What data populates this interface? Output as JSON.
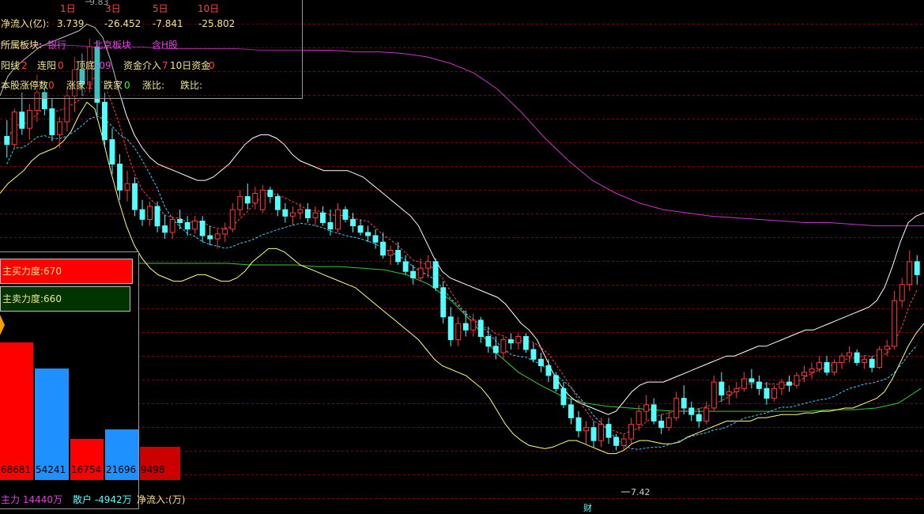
{
  "colors": {
    "up": "#ff3a3a",
    "down": "#54ffff",
    "upper_band": "#ffffff",
    "lower_band": "#ffff80",
    "ma_dashed_red": "#ff4040",
    "ma_dashed_cyan": "#40d0ff",
    "long_ma_magenta": "#cc33cc",
    "long_ma_green": "#33cc33",
    "grid": "#8b0000"
  },
  "info": {
    "periods": [
      "1日",
      "3日",
      "5日",
      "10日"
    ],
    "net_inflow_label": "净流入(亿):",
    "net_inflow_values": [
      "3.739",
      "-26.452",
      "-7.841",
      "-25.802"
    ],
    "sector_label": "所属板块:",
    "sector_items": [
      "银行",
      "北京板块",
      "含H股"
    ],
    "row3_yang_label": "阳线",
    "row3_yang_value": "2",
    "row3_lian_label": "连阳",
    "row3_lian_value": "0",
    "row3_ding_label": "顶底",
    "row3_ding_value": "-09",
    "row3_fund_in_label": "资金介入",
    "row3_fund_in_value": "7",
    "row3_ten_label": "10日资金",
    "row3_ten_value": "0",
    "row4_limit_label": "本股涨停数",
    "row4_limit_value": "0",
    "row4_up_label": "涨家",
    "row4_up_value": "1",
    "row4_down_label": "跌家",
    "row4_down_value": "0",
    "row4_upratio_label": "涨比:",
    "row4_downratio_label": "跌比:"
  },
  "fund_flow": {
    "buy_force": "主买力度:670",
    "sell_force": "主卖力度:660",
    "main_force": "主力 14440万",
    "retail": "散户 -4942万",
    "net_inflow": "净流入:(万)"
  },
  "annotations": {
    "high_price": "9.83",
    "low_price": "7.42",
    "marker_cai": "财"
  },
  "chart_data": {
    "type": "candlestick",
    "ylim": [
      7.15,
      10.15
    ],
    "grid": true,
    "candles": [
      [
        9.35,
        9.45,
        9.22,
        9.3
      ],
      [
        9.3,
        9.52,
        9.28,
        9.5
      ],
      [
        9.5,
        9.62,
        9.36,
        9.4
      ],
      [
        9.4,
        9.55,
        9.33,
        9.51
      ],
      [
        9.51,
        9.73,
        9.44,
        9.62
      ],
      [
        9.62,
        9.66,
        9.48,
        9.52
      ],
      [
        9.52,
        9.58,
        9.32,
        9.36
      ],
      [
        9.36,
        9.47,
        9.28,
        9.44
      ],
      [
        9.44,
        9.66,
        9.38,
        9.6
      ],
      [
        9.6,
        9.84,
        9.5,
        9.76
      ],
      [
        9.76,
        9.86,
        9.6,
        9.67
      ],
      [
        9.67,
        9.95,
        9.62,
        9.9
      ],
      [
        9.9,
        9.94,
        9.48,
        9.56
      ],
      [
        9.56,
        9.62,
        9.28,
        9.33
      ],
      [
        9.33,
        9.4,
        9.12,
        9.18
      ],
      [
        9.18,
        9.24,
        8.96,
        9.02
      ],
      [
        9.02,
        9.14,
        8.95,
        9.06
      ],
      [
        9.06,
        9.1,
        8.86,
        8.9
      ],
      [
        8.9,
        8.96,
        8.8,
        8.84
      ],
      [
        8.84,
        8.95,
        8.8,
        8.92
      ],
      [
        8.92,
        8.95,
        8.76,
        8.8
      ],
      [
        8.8,
        8.87,
        8.72,
        8.76
      ],
      [
        8.76,
        8.86,
        8.72,
        8.84
      ],
      [
        8.84,
        8.9,
        8.78,
        8.82
      ],
      [
        8.82,
        8.86,
        8.74,
        8.78
      ],
      [
        8.78,
        8.86,
        8.75,
        8.83
      ],
      [
        8.83,
        8.86,
        8.7,
        8.74
      ],
      [
        8.74,
        8.8,
        8.68,
        8.72
      ],
      [
        8.72,
        8.78,
        8.66,
        8.75
      ],
      [
        8.75,
        8.82,
        8.7,
        8.78
      ],
      [
        8.78,
        8.94,
        8.76,
        8.9
      ],
      [
        8.9,
        9.02,
        8.86,
        8.98
      ],
      [
        8.98,
        9.06,
        8.9,
        8.94
      ],
      [
        8.94,
        9.04,
        8.9,
        9.0
      ],
      [
        8.9,
        9.05,
        8.88,
        9.02
      ],
      [
        9.02,
        9.04,
        8.94,
        8.98
      ],
      [
        8.98,
        9.0,
        8.86,
        8.9
      ],
      [
        8.9,
        8.94,
        8.82,
        8.86
      ],
      [
        8.86,
        8.92,
        8.8,
        8.88
      ],
      [
        8.88,
        8.94,
        8.84,
        8.9
      ],
      [
        8.9,
        8.94,
        8.82,
        8.85
      ],
      [
        8.85,
        8.92,
        8.8,
        8.88
      ],
      [
        8.88,
        8.92,
        8.8,
        8.82
      ],
      [
        8.82,
        8.9,
        8.74,
        8.78
      ],
      [
        8.78,
        8.94,
        8.76,
        8.9
      ],
      [
        8.9,
        8.92,
        8.82,
        8.84
      ],
      [
        8.84,
        8.88,
        8.76,
        8.8
      ],
      [
        8.8,
        8.84,
        8.74,
        8.76
      ],
      [
        8.76,
        8.8,
        8.7,
        8.74
      ],
      [
        8.74,
        8.78,
        8.66,
        8.7
      ],
      [
        8.7,
        8.76,
        8.6,
        8.62
      ],
      [
        8.62,
        8.68,
        8.56,
        8.65
      ],
      [
        8.65,
        8.7,
        8.56,
        8.58
      ],
      [
        8.58,
        8.62,
        8.5,
        8.52
      ],
      [
        8.52,
        8.56,
        8.44,
        8.48
      ],
      [
        8.48,
        8.6,
        8.46,
        8.54
      ],
      [
        8.54,
        8.62,
        8.48,
        8.58
      ],
      [
        8.58,
        8.6,
        8.4,
        8.42
      ],
      [
        8.42,
        8.46,
        8.2,
        8.24
      ],
      [
        8.24,
        8.3,
        8.06,
        8.1
      ],
      [
        8.1,
        8.24,
        8.06,
        8.2
      ],
      [
        8.2,
        8.28,
        8.12,
        8.16
      ],
      [
        8.16,
        8.26,
        8.12,
        8.22
      ],
      [
        8.22,
        8.24,
        8.08,
        8.12
      ],
      [
        8.12,
        8.18,
        8.02,
        8.06
      ],
      [
        8.06,
        8.12,
        7.98,
        8.02
      ],
      [
        8.02,
        8.12,
        7.98,
        8.1
      ],
      [
        8.1,
        8.14,
        8.04,
        8.08
      ],
      [
        8.08,
        8.14,
        8.04,
        8.12
      ],
      [
        8.12,
        8.14,
        8.02,
        8.04
      ],
      [
        8.04,
        8.08,
        7.96,
        7.98
      ],
      [
        7.98,
        8.02,
        7.9,
        7.94
      ],
      [
        7.94,
        7.98,
        7.84,
        7.88
      ],
      [
        7.88,
        7.9,
        7.78,
        7.8
      ],
      [
        7.8,
        7.84,
        7.68,
        7.7
      ],
      [
        7.7,
        7.74,
        7.58,
        7.62
      ],
      [
        7.62,
        7.66,
        7.5,
        7.54
      ],
      [
        7.54,
        7.6,
        7.46,
        7.56
      ],
      [
        7.56,
        7.6,
        7.44,
        7.48
      ],
      [
        7.48,
        7.62,
        7.44,
        7.58
      ],
      [
        7.58,
        7.62,
        7.46,
        7.5
      ],
      [
        7.5,
        7.52,
        7.42,
        7.45
      ],
      [
        7.45,
        7.52,
        7.42,
        7.49
      ],
      [
        7.49,
        7.62,
        7.46,
        7.58
      ],
      [
        7.58,
        7.7,
        7.54,
        7.66
      ],
      [
        7.66,
        7.76,
        7.6,
        7.7
      ],
      [
        7.7,
        7.74,
        7.58,
        7.6
      ],
      [
        7.6,
        7.64,
        7.52,
        7.56
      ],
      [
        7.56,
        7.66,
        7.54,
        7.62
      ],
      [
        7.62,
        7.78,
        7.6,
        7.74
      ],
      [
        7.74,
        7.82,
        7.64,
        7.68
      ],
      [
        7.68,
        7.72,
        7.6,
        7.64
      ],
      [
        7.64,
        7.68,
        7.56,
        7.6
      ],
      [
        7.6,
        7.72,
        7.58,
        7.68
      ],
      [
        7.68,
        7.88,
        7.66,
        7.84
      ],
      [
        7.84,
        7.9,
        7.72,
        7.76
      ],
      [
        7.76,
        7.82,
        7.7,
        7.78
      ],
      [
        7.78,
        7.84,
        7.74,
        7.8
      ],
      [
        7.8,
        7.9,
        7.78,
        7.86
      ],
      [
        7.86,
        7.92,
        7.8,
        7.84
      ],
      [
        7.84,
        7.88,
        7.76,
        7.8
      ],
      [
        7.8,
        7.84,
        7.7,
        7.74
      ],
      [
        7.74,
        7.82,
        7.72,
        7.8
      ],
      [
        7.8,
        7.86,
        7.76,
        7.84
      ],
      [
        7.84,
        7.88,
        7.78,
        7.82
      ],
      [
        7.82,
        7.9,
        7.8,
        7.88
      ],
      [
        7.88,
        7.94,
        7.84,
        7.9
      ],
      [
        7.9,
        7.96,
        7.86,
        7.92
      ],
      [
        7.92,
        8.0,
        7.9,
        7.96
      ],
      [
        7.96,
        8.0,
        7.88,
        7.9
      ],
      [
        7.9,
        7.98,
        7.88,
        7.96
      ],
      [
        7.96,
        8.02,
        7.92,
        8.0
      ],
      [
        8.0,
        8.06,
        7.96,
        8.02
      ],
      [
        8.02,
        8.04,
        7.94,
        7.96
      ],
      [
        7.96,
        8.0,
        7.92,
        7.98
      ],
      [
        7.98,
        8.0,
        7.9,
        7.93
      ],
      [
        7.93,
        8.06,
        7.92,
        8.04
      ],
      [
        8.04,
        8.1,
        8.0,
        8.06
      ],
      [
        8.06,
        8.4,
        8.04,
        8.34
      ],
      [
        8.34,
        8.48,
        8.3,
        8.44
      ],
      [
        8.44,
        8.65,
        8.4,
        8.58
      ],
      [
        8.58,
        8.62,
        8.44,
        8.5
      ]
    ],
    "upper_band": [
      9.6,
      9.72,
      9.78,
      9.82,
      9.86,
      9.9,
      9.92,
      9.94,
      9.96,
      9.98,
      10.0,
      10.04,
      10.02,
      9.96,
      9.82,
      9.64,
      9.48,
      9.36,
      9.28,
      9.22,
      9.18,
      9.16,
      9.14,
      9.12,
      9.1,
      9.08,
      9.08,
      9.1,
      9.14,
      9.18,
      9.24,
      9.3,
      9.34,
      9.36,
      9.36,
      9.34,
      9.3,
      9.24,
      9.2,
      9.18,
      9.16,
      9.14,
      9.14,
      9.14,
      9.14,
      9.12,
      9.1,
      9.06,
      9.02,
      8.98,
      8.94,
      8.9,
      8.86,
      8.8,
      8.7,
      8.6,
      8.52,
      8.48,
      8.46,
      8.44,
      8.42,
      8.4,
      8.38,
      8.36,
      8.32,
      8.26,
      8.2,
      8.16,
      8.1,
      8.0,
      7.9,
      7.82,
      7.76,
      7.72,
      7.7,
      7.68,
      7.66,
      7.64,
      7.66,
      7.72,
      7.78,
      7.82,
      7.84,
      7.84,
      7.84,
      7.86,
      7.88,
      7.9,
      7.92,
      7.94,
      7.96,
      7.98,
      8.0,
      8.0,
      8.02,
      8.04,
      8.06,
      8.06,
      8.08,
      8.1,
      8.12,
      8.14,
      8.16,
      8.16,
      8.18,
      8.2,
      8.22,
      8.24,
      8.26,
      8.28,
      8.3,
      8.34,
      8.42,
      8.55,
      8.7,
      8.82,
      8.86,
      8.88
    ],
    "lower_band": [
      9.0,
      9.06,
      9.1,
      9.14,
      9.2,
      9.24,
      9.26,
      9.28,
      9.32,
      9.38,
      9.48,
      9.56,
      9.52,
      9.34,
      9.14,
      8.96,
      8.8,
      8.68,
      8.6,
      8.54,
      8.5,
      8.48,
      8.46,
      8.46,
      8.48,
      8.5,
      8.5,
      8.48,
      8.46,
      8.46,
      8.48,
      8.52,
      8.58,
      8.62,
      8.66,
      8.66,
      8.64,
      8.6,
      8.56,
      8.54,
      8.52,
      8.5,
      8.48,
      8.46,
      8.44,
      8.42,
      8.38,
      8.34,
      8.3,
      8.26,
      8.22,
      8.18,
      8.14,
      8.1,
      8.04,
      7.98,
      7.94,
      7.92,
      7.9,
      7.88,
      7.84,
      7.8,
      7.74,
      7.66,
      7.58,
      7.52,
      7.48,
      7.45,
      7.44,
      7.43,
      7.44,
      7.46,
      7.48,
      7.48,
      7.46,
      7.44,
      7.42,
      7.4,
      7.4,
      7.42,
      7.46,
      7.48,
      7.48,
      7.47,
      7.46,
      7.46,
      7.47,
      7.5,
      7.52,
      7.54,
      7.56,
      7.58,
      7.6,
      7.6,
      7.6,
      7.6,
      7.62,
      7.62,
      7.63,
      7.64,
      7.64,
      7.64,
      7.65,
      7.65,
      7.66,
      7.66,
      7.67,
      7.68,
      7.68,
      7.7,
      7.72,
      7.74,
      7.78,
      7.86,
      7.96,
      8.06,
      8.14,
      8.2
    ],
    "magenta_ma": [
      9.92,
      9.92,
      9.91,
      9.91,
      9.9,
      9.9,
      9.9,
      9.89,
      9.89,
      9.89,
      9.89,
      9.88,
      9.88,
      9.88,
      9.88,
      9.87,
      9.87,
      9.86,
      9.84,
      9.8,
      9.74,
      9.64,
      9.5,
      9.34,
      9.2,
      9.08,
      9.0,
      8.94,
      8.9,
      8.88,
      8.86,
      8.85,
      8.84,
      8.83,
      8.82,
      8.82,
      8.81,
      8.8,
      8.8,
      8.8
    ],
    "green_ma": [
      8.57,
      8.57,
      8.57,
      8.57,
      8.57,
      8.56,
      8.56,
      8.56,
      8.55,
      8.55,
      8.54,
      8.53,
      8.5,
      8.44,
      8.34,
      8.2,
      8.02,
      7.9,
      7.82,
      7.75,
      7.71,
      7.69,
      7.68,
      7.67,
      7.66,
      7.66,
      7.66,
      7.66,
      7.66,
      7.66,
      7.66,
      7.67,
      7.67,
      7.68,
      7.71,
      7.8
    ]
  }
}
